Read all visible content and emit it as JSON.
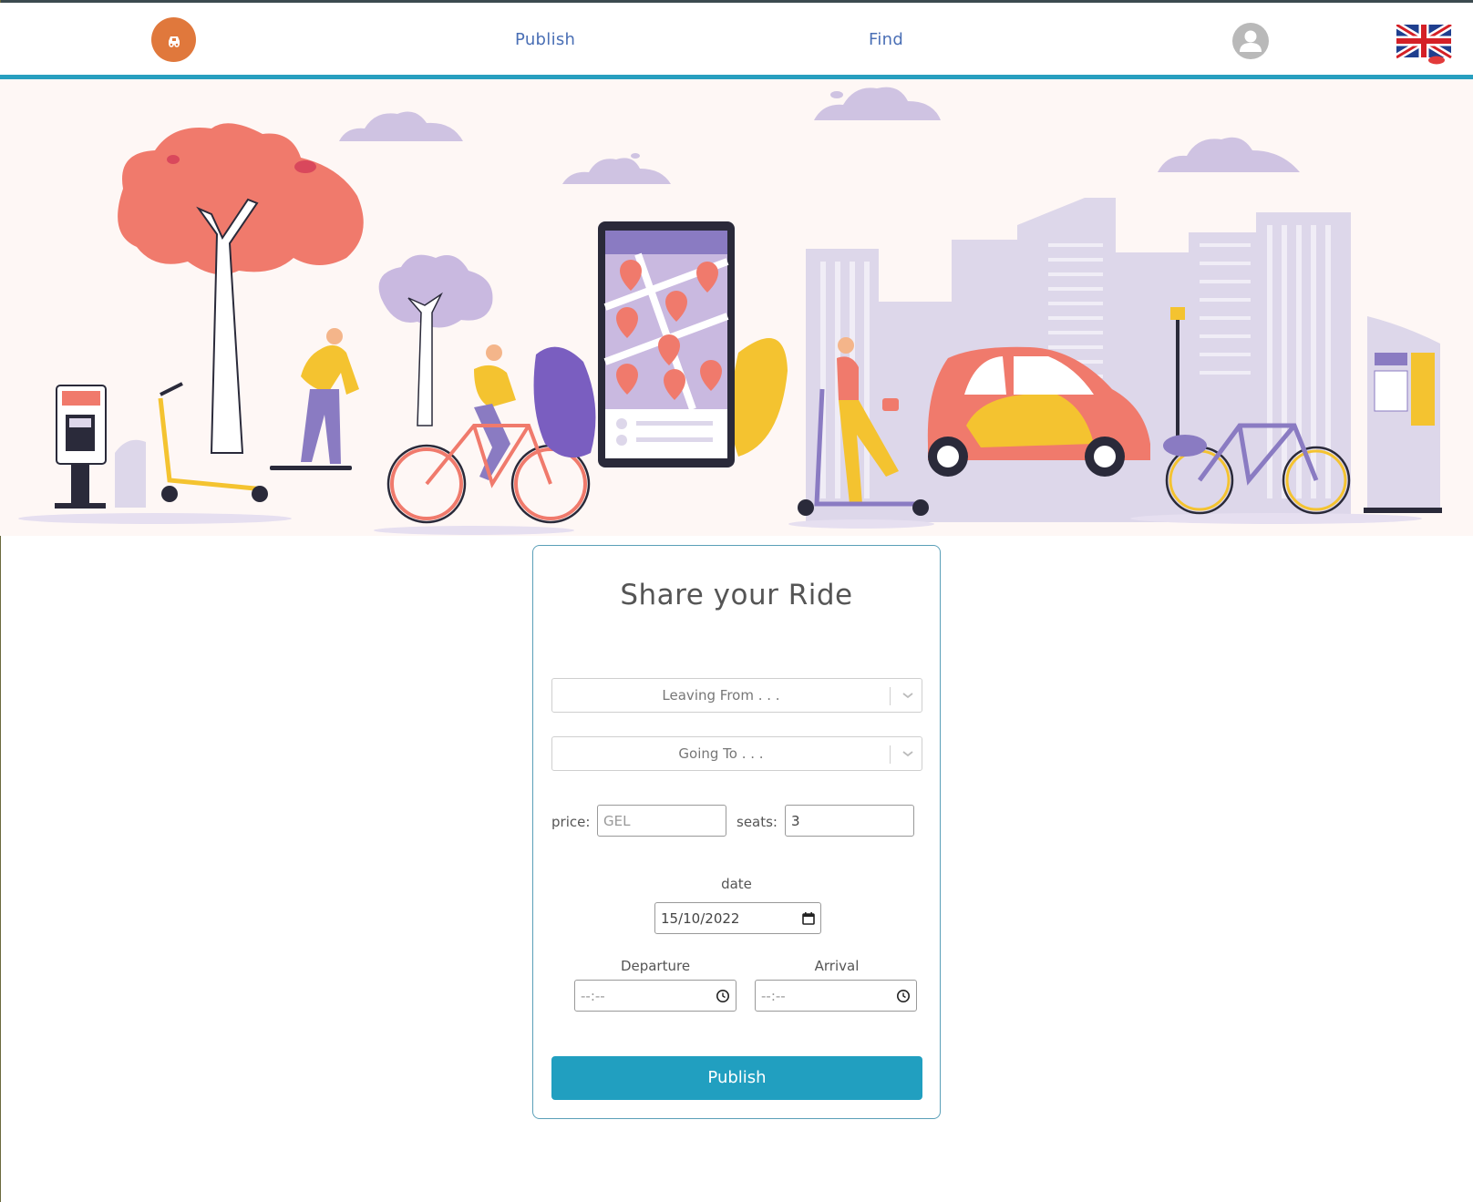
{
  "nav": {
    "publish_label": "Publish",
    "find_label": "Find",
    "logo_icon": "car-logo-icon",
    "avatar_icon": "user-avatar-icon",
    "language_icon": "uk-flag-icon"
  },
  "hero": {
    "illustration": "city-mobility-illustration"
  },
  "form": {
    "title": "Share your Ride",
    "leaving_from_placeholder": "Leaving From . . .",
    "going_to_placeholder": "Going To . . .",
    "price_label": "price:",
    "price_placeholder": "GEL",
    "seats_label": "seats:",
    "seats_value": "3",
    "date_label": "date",
    "date_value": "15/10/2022",
    "departure_label": "Departure",
    "departure_value": "--:--",
    "arrival_label": "Arrival",
    "arrival_value": "--:--",
    "publish_button": "Publish"
  },
  "colors": {
    "accent": "#219fc0",
    "nav_link": "#4a6fb5",
    "logo_bg": "#e0783c",
    "hero_bg": "#fef7f5"
  }
}
